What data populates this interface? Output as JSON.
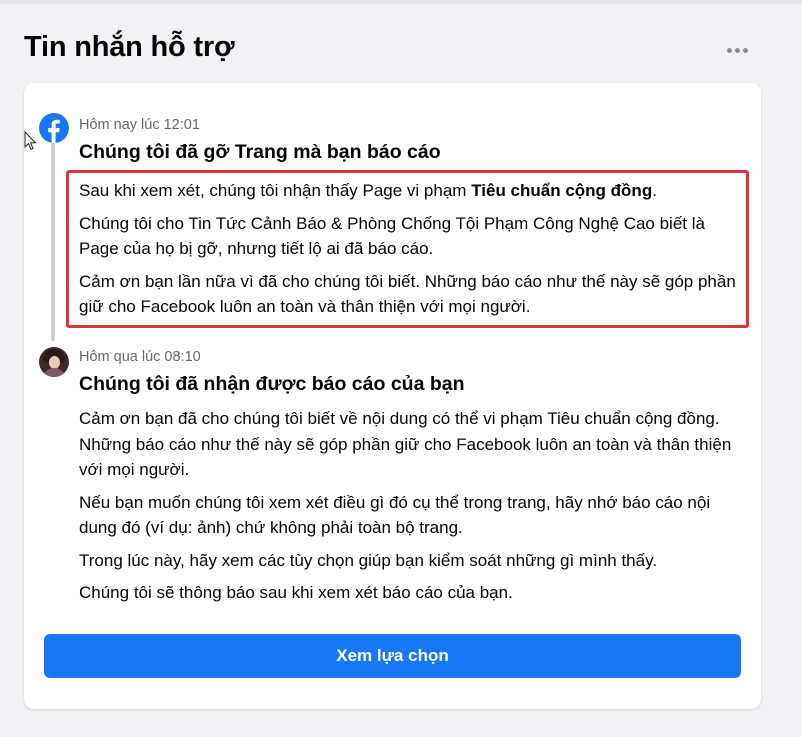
{
  "header": {
    "title": "Tin nhắn hỗ trợ",
    "more_icon": "more-horizontal-icon"
  },
  "messages": [
    {
      "sender_icon": "facebook-logo-icon",
      "timestamp": "Hôm nay lúc 12:01",
      "title": "Chúng tôi đã gỡ Trang mà bạn báo cáo",
      "highlighted": true,
      "paragraphs": [
        {
          "prefix": "Sau khi xem xét, chúng tôi nhận thấy Page vi phạm ",
          "bold": "Tiêu chuẩn cộng đồng",
          "suffix": "."
        },
        {
          "text": "Chúng tôi cho Tin Tức Cảnh Báo & Phòng Chống Tội Phạm Công Nghệ Cao biết là Page của họ bị gỡ, nhưng tiết lộ ai đã báo cáo."
        },
        {
          "text": "Cảm ơn bạn lần nữa vì đã cho chúng tôi biết. Những báo cáo như thế này sẽ góp phần giữ cho Facebook luôn an toàn và thân thiện với mọi người."
        }
      ]
    },
    {
      "sender_icon": "user-avatar",
      "timestamp": "Hôm qua lúc 08:10",
      "title": "Chúng tôi đã nhận được báo cáo của bạn",
      "paragraphs": [
        {
          "text": "Cảm ơn bạn đã cho chúng tôi biết về nội dung có thể vi phạm Tiêu chuẩn cộng đồng. Những báo cáo như thế này sẽ góp phần giữ cho Facebook luôn an toàn và thân thiện với mọi người."
        },
        {
          "text": "Nếu bạn muốn chúng tôi xem xét điều gì đó cụ thể trong trang, hãy nhớ báo cáo nội dung đó (ví dụ: ảnh) chứ không phải toàn bộ trang."
        },
        {
          "text": "Trong lúc này, hãy xem các tùy chọn giúp bạn kiểm soát những gì mình thấy."
        },
        {
          "text": "Chúng tôi sẽ thông báo sau khi xem xét báo cáo của bạn."
        }
      ]
    }
  ],
  "actions": {
    "see_options_label": "Xem lựa chọn"
  },
  "colors": {
    "accent": "#1877f2",
    "highlight_border": "#e0333a",
    "muted_text": "#65676b"
  }
}
